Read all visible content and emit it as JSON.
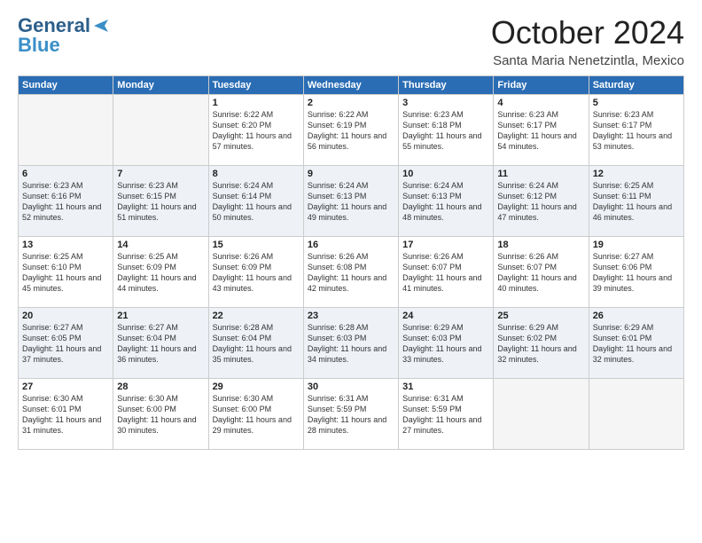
{
  "header": {
    "logo_line1": "General",
    "logo_line2": "Blue",
    "month": "October 2024",
    "location": "Santa Maria Nenetzintla, Mexico"
  },
  "days_of_week": [
    "Sunday",
    "Monday",
    "Tuesday",
    "Wednesday",
    "Thursday",
    "Friday",
    "Saturday"
  ],
  "weeks": [
    [
      {
        "day": "",
        "info": ""
      },
      {
        "day": "",
        "info": ""
      },
      {
        "day": "1",
        "info": "Sunrise: 6:22 AM\nSunset: 6:20 PM\nDaylight: 11 hours and 57 minutes."
      },
      {
        "day": "2",
        "info": "Sunrise: 6:22 AM\nSunset: 6:19 PM\nDaylight: 11 hours and 56 minutes."
      },
      {
        "day": "3",
        "info": "Sunrise: 6:23 AM\nSunset: 6:18 PM\nDaylight: 11 hours and 55 minutes."
      },
      {
        "day": "4",
        "info": "Sunrise: 6:23 AM\nSunset: 6:17 PM\nDaylight: 11 hours and 54 minutes."
      },
      {
        "day": "5",
        "info": "Sunrise: 6:23 AM\nSunset: 6:17 PM\nDaylight: 11 hours and 53 minutes."
      }
    ],
    [
      {
        "day": "6",
        "info": "Sunrise: 6:23 AM\nSunset: 6:16 PM\nDaylight: 11 hours and 52 minutes."
      },
      {
        "day": "7",
        "info": "Sunrise: 6:23 AM\nSunset: 6:15 PM\nDaylight: 11 hours and 51 minutes."
      },
      {
        "day": "8",
        "info": "Sunrise: 6:24 AM\nSunset: 6:14 PM\nDaylight: 11 hours and 50 minutes."
      },
      {
        "day": "9",
        "info": "Sunrise: 6:24 AM\nSunset: 6:13 PM\nDaylight: 11 hours and 49 minutes."
      },
      {
        "day": "10",
        "info": "Sunrise: 6:24 AM\nSunset: 6:13 PM\nDaylight: 11 hours and 48 minutes."
      },
      {
        "day": "11",
        "info": "Sunrise: 6:24 AM\nSunset: 6:12 PM\nDaylight: 11 hours and 47 minutes."
      },
      {
        "day": "12",
        "info": "Sunrise: 6:25 AM\nSunset: 6:11 PM\nDaylight: 11 hours and 46 minutes."
      }
    ],
    [
      {
        "day": "13",
        "info": "Sunrise: 6:25 AM\nSunset: 6:10 PM\nDaylight: 11 hours and 45 minutes."
      },
      {
        "day": "14",
        "info": "Sunrise: 6:25 AM\nSunset: 6:09 PM\nDaylight: 11 hours and 44 minutes."
      },
      {
        "day": "15",
        "info": "Sunrise: 6:26 AM\nSunset: 6:09 PM\nDaylight: 11 hours and 43 minutes."
      },
      {
        "day": "16",
        "info": "Sunrise: 6:26 AM\nSunset: 6:08 PM\nDaylight: 11 hours and 42 minutes."
      },
      {
        "day": "17",
        "info": "Sunrise: 6:26 AM\nSunset: 6:07 PM\nDaylight: 11 hours and 41 minutes."
      },
      {
        "day": "18",
        "info": "Sunrise: 6:26 AM\nSunset: 6:07 PM\nDaylight: 11 hours and 40 minutes."
      },
      {
        "day": "19",
        "info": "Sunrise: 6:27 AM\nSunset: 6:06 PM\nDaylight: 11 hours and 39 minutes."
      }
    ],
    [
      {
        "day": "20",
        "info": "Sunrise: 6:27 AM\nSunset: 6:05 PM\nDaylight: 11 hours and 37 minutes."
      },
      {
        "day": "21",
        "info": "Sunrise: 6:27 AM\nSunset: 6:04 PM\nDaylight: 11 hours and 36 minutes."
      },
      {
        "day": "22",
        "info": "Sunrise: 6:28 AM\nSunset: 6:04 PM\nDaylight: 11 hours and 35 minutes."
      },
      {
        "day": "23",
        "info": "Sunrise: 6:28 AM\nSunset: 6:03 PM\nDaylight: 11 hours and 34 minutes."
      },
      {
        "day": "24",
        "info": "Sunrise: 6:29 AM\nSunset: 6:03 PM\nDaylight: 11 hours and 33 minutes."
      },
      {
        "day": "25",
        "info": "Sunrise: 6:29 AM\nSunset: 6:02 PM\nDaylight: 11 hours and 32 minutes."
      },
      {
        "day": "26",
        "info": "Sunrise: 6:29 AM\nSunset: 6:01 PM\nDaylight: 11 hours and 32 minutes."
      }
    ],
    [
      {
        "day": "27",
        "info": "Sunrise: 6:30 AM\nSunset: 6:01 PM\nDaylight: 11 hours and 31 minutes."
      },
      {
        "day": "28",
        "info": "Sunrise: 6:30 AM\nSunset: 6:00 PM\nDaylight: 11 hours and 30 minutes."
      },
      {
        "day": "29",
        "info": "Sunrise: 6:30 AM\nSunset: 6:00 PM\nDaylight: 11 hours and 29 minutes."
      },
      {
        "day": "30",
        "info": "Sunrise: 6:31 AM\nSunset: 5:59 PM\nDaylight: 11 hours and 28 minutes."
      },
      {
        "day": "31",
        "info": "Sunrise: 6:31 AM\nSunset: 5:59 PM\nDaylight: 11 hours and 27 minutes."
      },
      {
        "day": "",
        "info": ""
      },
      {
        "day": "",
        "info": ""
      }
    ]
  ]
}
